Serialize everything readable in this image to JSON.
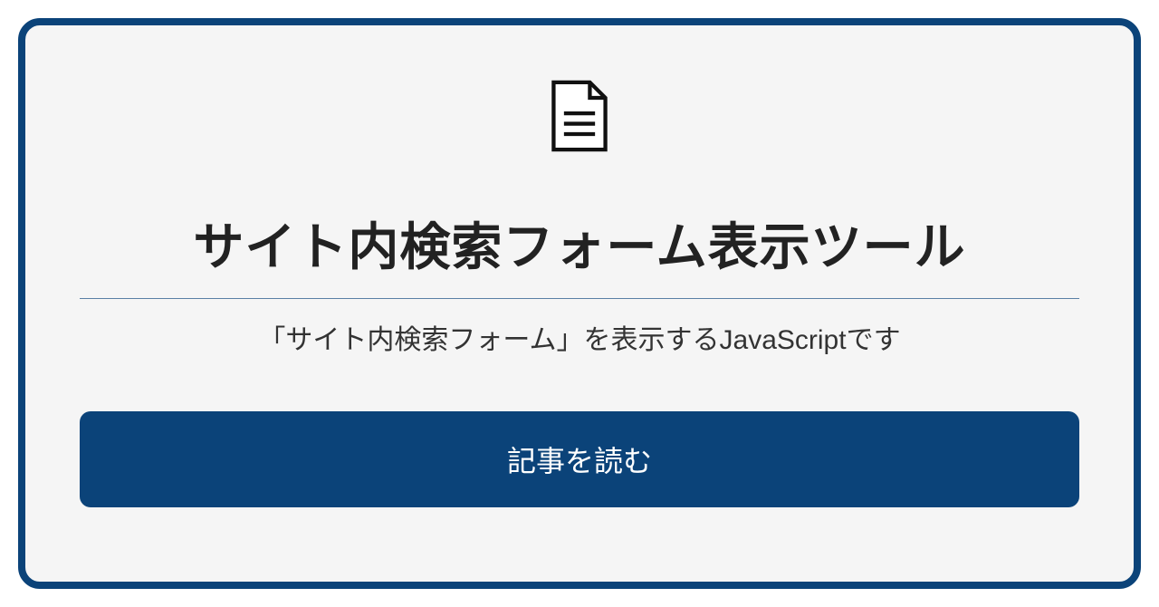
{
  "card": {
    "title": "サイト内検索フォーム表示ツール",
    "subtitle": "「サイト内検索フォーム」を表示するJavaScriptです",
    "button_label": "記事を読む"
  },
  "colors": {
    "border": "#0b4379",
    "button_bg": "#0b4379",
    "card_bg": "#f5f5f5"
  }
}
